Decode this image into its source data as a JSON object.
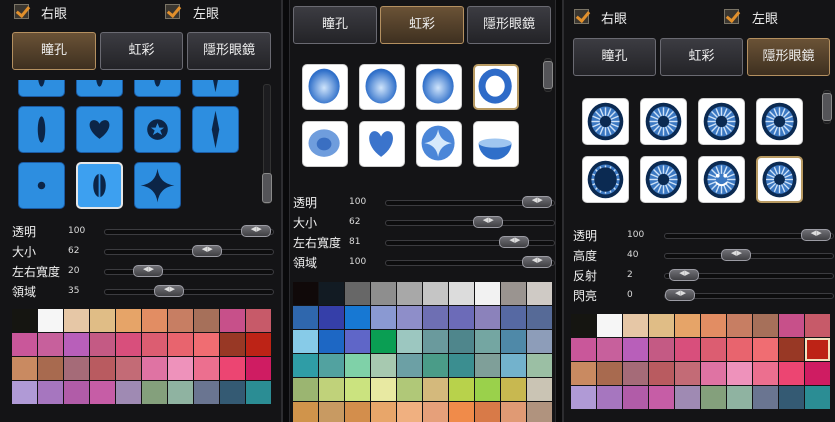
{
  "panels": [
    {
      "id": "left",
      "checkboxes": [
        {
          "label": "右眼",
          "checked": true
        },
        {
          "label": "左眼",
          "checked": true
        }
      ],
      "tabs": [
        {
          "label": "瞳孔",
          "active": true
        },
        {
          "label": "虹彩",
          "active": false
        },
        {
          "label": "隱形眼鏡",
          "active": false
        }
      ],
      "icons": {
        "style": "pupil",
        "shapes": [
          "slit-top",
          "slit-top",
          "slit-top",
          "diamond-top",
          "slit",
          "heart",
          "star-cutout",
          "diamond-slit",
          "dot",
          "oval-slit",
          "sparkle"
        ],
        "selected_index": 9
      },
      "sliders": [
        {
          "label": "透明",
          "value": "100",
          "level": 97
        },
        {
          "label": "大小",
          "value": "62",
          "level": 62
        },
        {
          "label": "左右寬度",
          "value": "20",
          "level": 20
        },
        {
          "label": "領域",
          "value": "35",
          "level": 35
        }
      ],
      "palette": {
        "cols": 10,
        "selected": -1,
        "colors": [
          "#151511",
          "#f6f6f6",
          "#e6c7a6",
          "#e0bd86",
          "#e6a468",
          "#e28d63",
          "#c77e63",
          "#a6705a",
          "#c7508a",
          "#c75a69",
          "#c9579a",
          "#c7609c",
          "#b85fba",
          "#c45a84",
          "#d84f7c",
          "#dc5d71",
          "#e8646e",
          "#f06d72",
          "#983825",
          "#bd2316",
          "#c98a61",
          "#a86a4f",
          "#a56b78",
          "#b95b60",
          "#c36b76",
          "#df73a3",
          "#ee92bb",
          "#ec6f8f",
          "#ec4572",
          "#cf1c62",
          "#b09ad6",
          "#a676bf",
          "#b15ca8",
          "#c65da6",
          "#9f8ab3",
          "#84a07c",
          "#8fb3a1",
          "#6a7591",
          "#345a73",
          "#2b8d94"
        ]
      }
    },
    {
      "id": "center",
      "tabs": [
        {
          "label": "瞳孔",
          "active": false
        },
        {
          "label": "虹彩",
          "active": true
        },
        {
          "label": "隱形眼鏡",
          "active": false
        }
      ],
      "icons": {
        "style": "iris",
        "shapes": [
          "oval-soft",
          "oval-light",
          "dome",
          "ring",
          "oval-ring",
          "heart",
          "sparkle-round",
          "half-glow"
        ],
        "selected_index": 3
      },
      "sliders": [
        {
          "label": "透明",
          "value": "100",
          "level": 97
        },
        {
          "label": "大小",
          "value": "62",
          "level": 62
        },
        {
          "label": "左右寬度",
          "value": "81",
          "level": 81
        },
        {
          "label": "領域",
          "value": "100",
          "level": 97
        }
      ],
      "palette": {
        "cols": 10,
        "selected": -1,
        "colors": [
          "#100909",
          "#121b23",
          "#676767",
          "#8e8e8e",
          "#a8a8a8",
          "#c5c5c5",
          "#dcdcdc",
          "#f2f2f2",
          "#9a9490",
          "#cfcac5",
          "#2f67ad",
          "#353fa9",
          "#1778d3",
          "#8a99d2",
          "#8e8ec9",
          "#6e6fb3",
          "#6c6bb8",
          "#8b82bb",
          "#5669a3",
          "#566a97",
          "#87cbe8",
          "#1d67c4",
          "#5f66c8",
          "#0a9e53",
          "#9cc7c0",
          "#6a9a9d",
          "#4f868c",
          "#74a6a2",
          "#4f89a8",
          "#8d9db9",
          "#2f9da6",
          "#52a2a0",
          "#7fd1a8",
          "#a7c9b0",
          "#6ca0a5",
          "#4a9c88",
          "#3b8e90",
          "#7f9f99",
          "#73b2cc",
          "#9bbfa4",
          "#9bb571",
          "#c0d27a",
          "#cbe37f",
          "#e8e9a2",
          "#b0c878",
          "#d4b97c",
          "#b8d24b",
          "#9ad14b",
          "#c8b850",
          "#cac4b4",
          "#d0944b",
          "#c89a62",
          "#d38e4c",
          "#e8a66a",
          "#f0b080",
          "#e6a07a",
          "#f08b4a",
          "#d87a48",
          "#e09a74",
          "#b0937e"
        ]
      }
    },
    {
      "id": "right",
      "checkboxes": [
        {
          "label": "右眼",
          "checked": true
        },
        {
          "label": "左眼",
          "checked": true
        }
      ],
      "tabs": [
        {
          "label": "瞳孔",
          "active": false
        },
        {
          "label": "虹彩",
          "active": false
        },
        {
          "label": "隱形眼鏡",
          "active": true
        }
      ],
      "icons": {
        "style": "lens",
        "shapes": [
          "lens-flower",
          "lens-spike",
          "lens-rays",
          "lens-rays-inner",
          "lens-ring",
          "lens-flower-ring",
          "lens-face",
          "lens-spiral"
        ],
        "selected_index": 7
      },
      "sliders": [
        {
          "label": "透明",
          "value": "100",
          "level": 97
        },
        {
          "label": "高度",
          "value": "40",
          "level": 40
        },
        {
          "label": "反射",
          "value": "2",
          "level": 3
        },
        {
          "label": "閃亮",
          "value": "0",
          "level": 0
        }
      ],
      "palette": {
        "cols": 10,
        "selected": 19,
        "colors": [
          "#151511",
          "#f6f6f6",
          "#e6c7a6",
          "#e0bd86",
          "#e6a468",
          "#e28d63",
          "#c77e63",
          "#a6705a",
          "#c7508a",
          "#c75a69",
          "#c9579a",
          "#c7609c",
          "#b85fba",
          "#c45a84",
          "#d84f7c",
          "#dc5d71",
          "#e8646e",
          "#f06d72",
          "#983825",
          "#bd2316",
          "#c98a61",
          "#a86a4f",
          "#a56b78",
          "#b95b60",
          "#c36b76",
          "#df73a3",
          "#ee92bb",
          "#ec6f8f",
          "#ec4572",
          "#cf1c62",
          "#b09ad6",
          "#a676bf",
          "#b15ca8",
          "#c65da6",
          "#9f8ab3",
          "#84a07c",
          "#8fb3a1",
          "#6a7591",
          "#345a73",
          "#2b8d94"
        ]
      }
    }
  ]
}
